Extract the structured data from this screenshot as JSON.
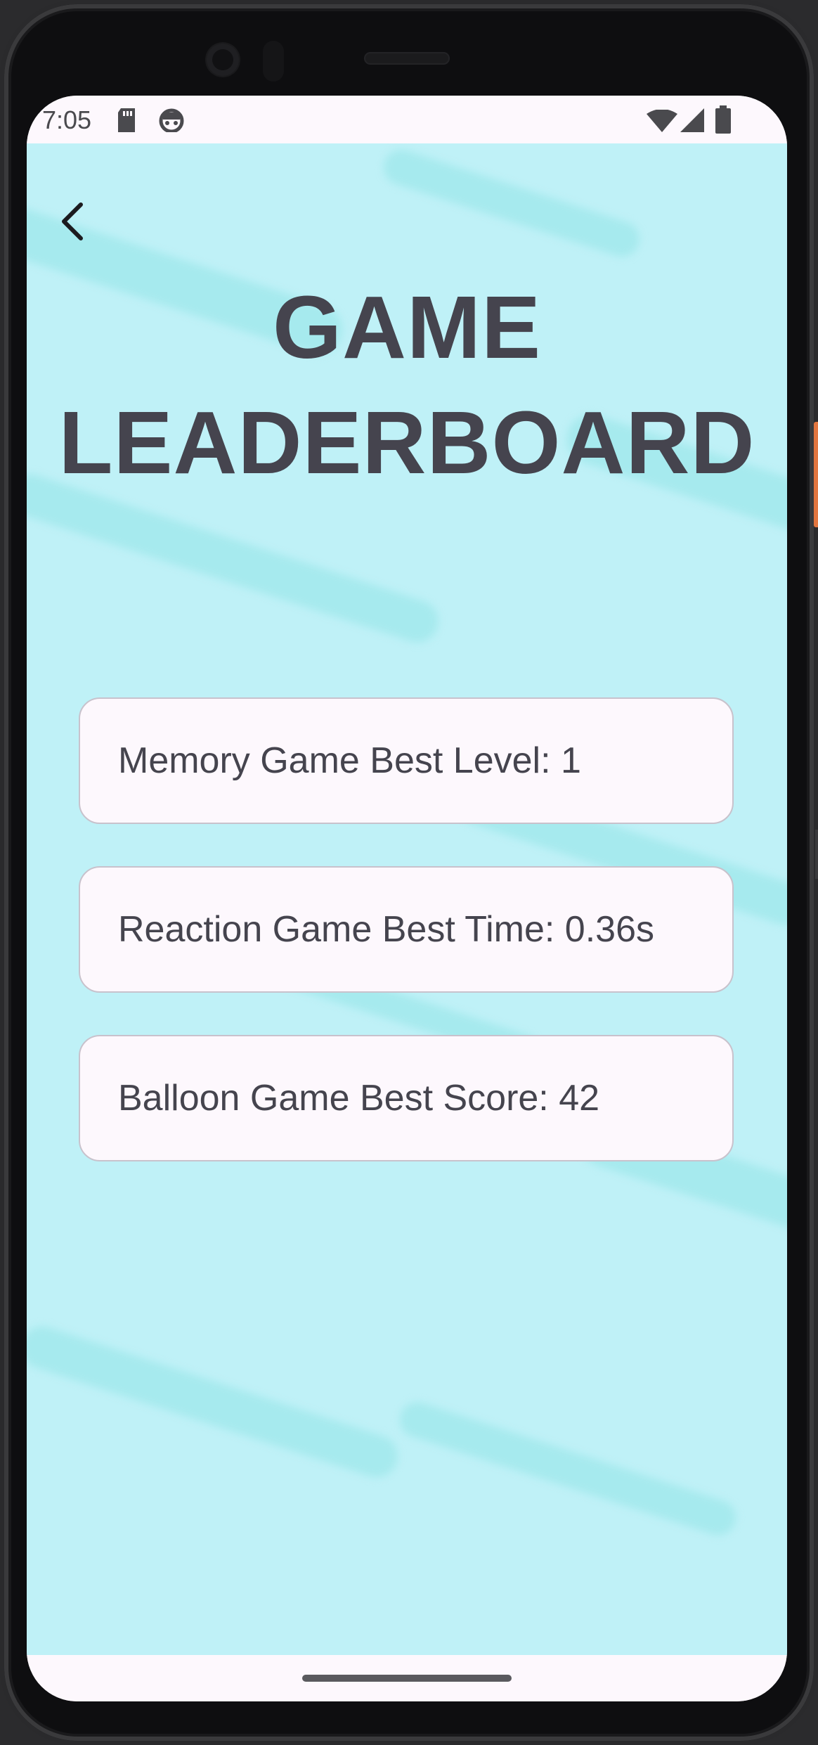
{
  "status_bar": {
    "time": "7:05",
    "icons": [
      "sd-card-icon",
      "android-face-icon",
      "wifi-icon",
      "cellular-signal-icon",
      "battery-icon"
    ]
  },
  "header": {
    "back_icon": "chevron-left-icon",
    "title_line1": "GAME",
    "title_line2": "LEADERBOARD"
  },
  "leaderboard": {
    "items": [
      {
        "label": "Memory Game Best Level: 1"
      },
      {
        "label": "Reaction Game Best Time: 0.36s"
      },
      {
        "label": "Balloon Game Best Score: 42"
      }
    ]
  },
  "colors": {
    "background": "#bff1f7",
    "title": "#45444e",
    "card_background": "#fdf8fd",
    "card_border": "#c8c2cc"
  }
}
